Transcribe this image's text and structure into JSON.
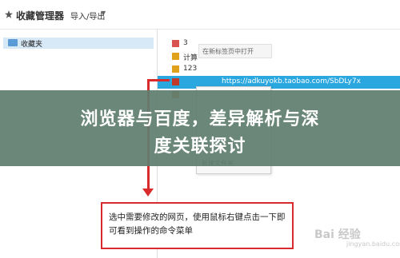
{
  "window": {
    "title": "收藏管理器",
    "menu_import_export": "导入/导出"
  },
  "sidebar": {
    "items": [
      {
        "label": "收藏夹"
      }
    ]
  },
  "list": {
    "rows": [
      {
        "label": "3",
        "icon_color": "#d9534f"
      },
      {
        "label": "",
        "icon_color": "#e0a21a"
      },
      {
        "label": "3",
        "icon_color": "#e0a21a"
      },
      {
        "label": "",
        "icon_color": "#c0392b"
      },
      {
        "label": "",
        "icon_color": "#e06c2b"
      },
      {
        "label": "",
        "icon_color": "#e07a2b"
      }
    ],
    "row2_suffix": "计算",
    "row3_suffix": "123",
    "selected_url": "https://adkuyokb.taobao.com/SbDLy7x"
  },
  "context_menu": {
    "first_item": "在新标签页中打开",
    "items": [
      "",
      "",
      "",
      "",
      "新建文件夹"
    ]
  },
  "overlay": {
    "line1": "浏览器与百度，差异解析与深",
    "line2": "度关联探讨"
  },
  "note": {
    "text": "选中需要修改的网页，使用鼠标右键点击一下即可看到操作的命令菜单"
  },
  "watermark": {
    "brand": "Bai 经验",
    "sub": "jingyan.baidu.com"
  },
  "colors": {
    "selection": "#2aa7df",
    "annotation_red": "#d92b2b",
    "overlay": "#5f7e6f"
  }
}
